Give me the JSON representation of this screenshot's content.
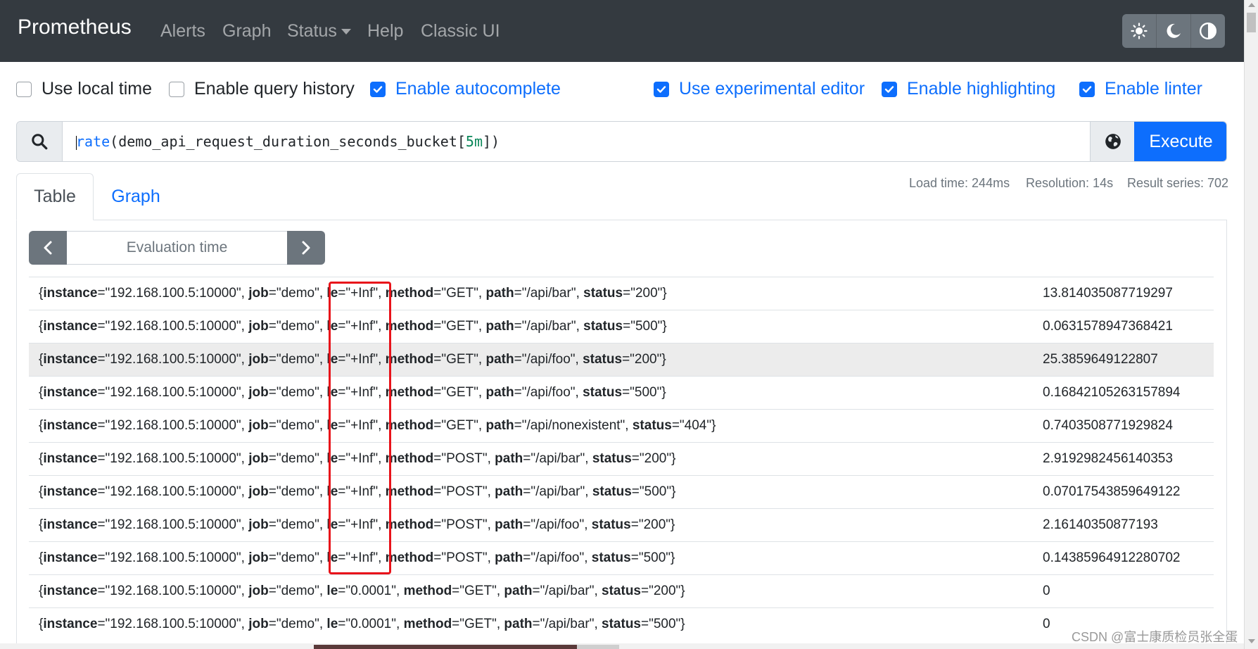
{
  "navbar": {
    "brand": "Prometheus",
    "links": [
      "Alerts",
      "Graph",
      "Status",
      "Help",
      "Classic UI"
    ],
    "theme_buttons": [
      "sun-icon",
      "moon-icon",
      "contrast-icon"
    ]
  },
  "options": [
    {
      "label": "Use local time",
      "checked": false
    },
    {
      "label": "Enable query history",
      "checked": false
    },
    {
      "label": "Enable autocomplete",
      "checked": true
    },
    {
      "label": "Use experimental editor",
      "checked": true
    },
    {
      "label": "Enable highlighting",
      "checked": true
    },
    {
      "label": "Enable linter",
      "checked": true
    }
  ],
  "query": {
    "fn": "rate",
    "open": "(",
    "metric": "demo_api_request_duration_seconds_bucket",
    "lb": "[",
    "range": "5m",
    "rb": "])",
    "execute_label": "Execute"
  },
  "tabs": {
    "table": "Table",
    "graph": "Graph"
  },
  "stats": {
    "load_time": "Load time: 244ms",
    "resolution": "Resolution: 14s",
    "result_series": "Result series: 702"
  },
  "eval_time_placeholder": "Evaluation time",
  "rows": [
    {
      "labels": [
        [
          "instance",
          "192.168.100.5:10000"
        ],
        [
          "job",
          "demo"
        ],
        [
          "le",
          "+Inf"
        ],
        [
          "method",
          "GET"
        ],
        [
          "path",
          "/api/bar"
        ],
        [
          "status",
          "200"
        ]
      ],
      "value": "13.814035087719297"
    },
    {
      "labels": [
        [
          "instance",
          "192.168.100.5:10000"
        ],
        [
          "job",
          "demo"
        ],
        [
          "le",
          "+Inf"
        ],
        [
          "method",
          "GET"
        ],
        [
          "path",
          "/api/bar"
        ],
        [
          "status",
          "500"
        ]
      ],
      "value": "0.0631578947368421"
    },
    {
      "labels": [
        [
          "instance",
          "192.168.100.5:10000"
        ],
        [
          "job",
          "demo"
        ],
        [
          "le",
          "+Inf"
        ],
        [
          "method",
          "GET"
        ],
        [
          "path",
          "/api/foo"
        ],
        [
          "status",
          "200"
        ]
      ],
      "value": "25.3859649122807"
    },
    {
      "labels": [
        [
          "instance",
          "192.168.100.5:10000"
        ],
        [
          "job",
          "demo"
        ],
        [
          "le",
          "+Inf"
        ],
        [
          "method",
          "GET"
        ],
        [
          "path",
          "/api/foo"
        ],
        [
          "status",
          "500"
        ]
      ],
      "value": "0.16842105263157894"
    },
    {
      "labels": [
        [
          "instance",
          "192.168.100.5:10000"
        ],
        [
          "job",
          "demo"
        ],
        [
          "le",
          "+Inf"
        ],
        [
          "method",
          "GET"
        ],
        [
          "path",
          "/api/nonexistent"
        ],
        [
          "status",
          "404"
        ]
      ],
      "value": "0.7403508771929824"
    },
    {
      "labels": [
        [
          "instance",
          "192.168.100.5:10000"
        ],
        [
          "job",
          "demo"
        ],
        [
          "le",
          "+Inf"
        ],
        [
          "method",
          "POST"
        ],
        [
          "path",
          "/api/bar"
        ],
        [
          "status",
          "200"
        ]
      ],
      "value": "2.9192982456140353"
    },
    {
      "labels": [
        [
          "instance",
          "192.168.100.5:10000"
        ],
        [
          "job",
          "demo"
        ],
        [
          "le",
          "+Inf"
        ],
        [
          "method",
          "POST"
        ],
        [
          "path",
          "/api/bar"
        ],
        [
          "status",
          "500"
        ]
      ],
      "value": "0.07017543859649122"
    },
    {
      "labels": [
        [
          "instance",
          "192.168.100.5:10000"
        ],
        [
          "job",
          "demo"
        ],
        [
          "le",
          "+Inf"
        ],
        [
          "method",
          "POST"
        ],
        [
          "path",
          "/api/foo"
        ],
        [
          "status",
          "200"
        ]
      ],
      "value": "2.16140350877193"
    },
    {
      "labels": [
        [
          "instance",
          "192.168.100.5:10000"
        ],
        [
          "job",
          "demo"
        ],
        [
          "le",
          "+Inf"
        ],
        [
          "method",
          "POST"
        ],
        [
          "path",
          "/api/foo"
        ],
        [
          "status",
          "500"
        ]
      ],
      "value": "0.14385964912280702"
    },
    {
      "labels": [
        [
          "instance",
          "192.168.100.5:10000"
        ],
        [
          "job",
          "demo"
        ],
        [
          "le",
          "0.0001"
        ],
        [
          "method",
          "GET"
        ],
        [
          "path",
          "/api/bar"
        ],
        [
          "status",
          "200"
        ]
      ],
      "value": "0"
    },
    {
      "labels": [
        [
          "instance",
          "192.168.100.5:10000"
        ],
        [
          "job",
          "demo"
        ],
        [
          "le",
          "0.0001"
        ],
        [
          "method",
          "GET"
        ],
        [
          "path",
          "/api/bar"
        ],
        [
          "status",
          "500"
        ]
      ],
      "value": "0"
    }
  ],
  "hovered_row": 2,
  "watermark": "CSDN @富士康质检员张全蛋",
  "colors": {
    "navbar": "#343a40",
    "accent": "#0d6efd",
    "annotation": "#e8131a"
  }
}
